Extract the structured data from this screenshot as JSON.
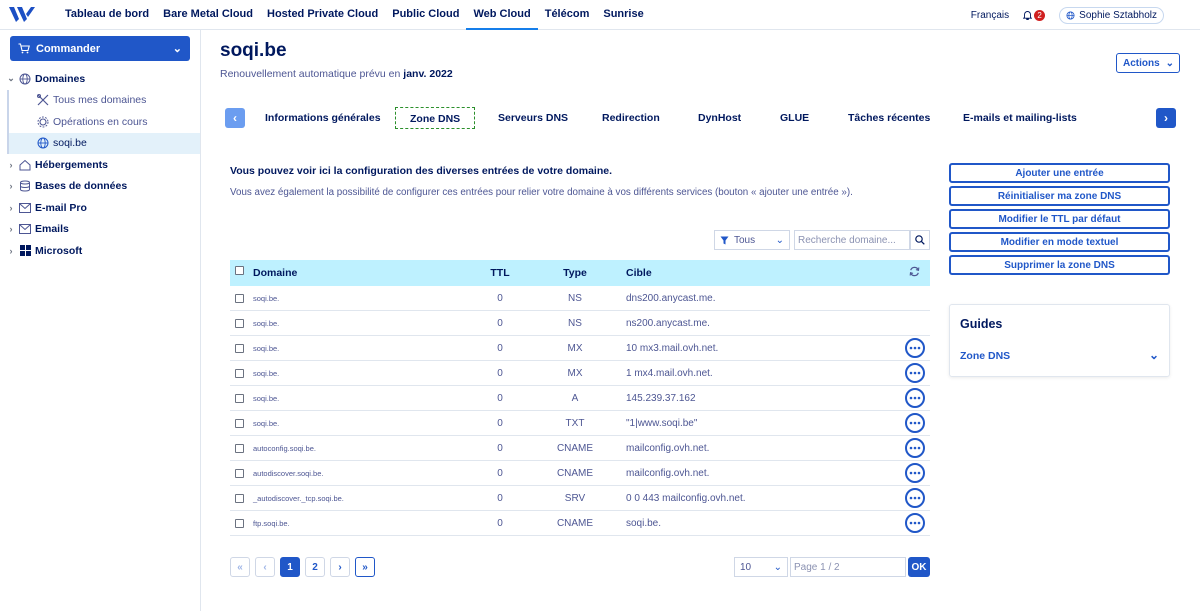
{
  "topnav": {
    "links": [
      "Tableau de bord",
      "Bare Metal Cloud",
      "Hosted Private Cloud",
      "Public Cloud",
      "Web Cloud",
      "Télécom",
      "Sunrise"
    ],
    "active_index": 4,
    "language": "Français",
    "notif_count": "2",
    "user_name": "Sophie Sztabholz"
  },
  "sidebar": {
    "command_label": "Commander",
    "domaines": "Domaines",
    "sub_items": [
      "Tous mes domaines",
      "Opérations en cours",
      "soqi.be"
    ],
    "sections": [
      "Hébergements",
      "Bases de données",
      "E-mail Pro",
      "Emails",
      "Microsoft"
    ]
  },
  "header": {
    "title": "soqi.be",
    "renewal_prefix": "Renouvellement automatique prévu en ",
    "renewal_date": "janv. 2022",
    "actions_label": "Actions"
  },
  "tabs": [
    "Informations générales",
    "Zone DNS",
    "Serveurs DNS",
    "Redirection",
    "DynHost",
    "GLUE",
    "Tâches récentes",
    "E-mails et mailing-lists"
  ],
  "tabs_active_index": 1,
  "intro": {
    "line1": "Vous pouvez voir ici la configuration des diverses entrées de votre domaine.",
    "line2": "Vous avez également la possibilité de configurer ces entrées pour relier votre domaine à vos différents services (bouton « ajouter une entrée »)."
  },
  "filter": {
    "select_value": "Tous",
    "search_placeholder": "Recherche domaine..."
  },
  "table": {
    "headers": {
      "domain": "Domaine",
      "ttl": "TTL",
      "type": "Type",
      "target": "Cible"
    },
    "rows": [
      {
        "domain": "soqi.be.",
        "ttl": "0",
        "type": "NS",
        "target": "dns200.anycast.me.",
        "menu": false
      },
      {
        "domain": "soqi.be.",
        "ttl": "0",
        "type": "NS",
        "target": "ns200.anycast.me.",
        "menu": false
      },
      {
        "domain": "soqi.be.",
        "ttl": "0",
        "type": "MX",
        "target": "10 mx3.mail.ovh.net.",
        "menu": true
      },
      {
        "domain": "soqi.be.",
        "ttl": "0",
        "type": "MX",
        "target": "1 mx4.mail.ovh.net.",
        "menu": true
      },
      {
        "domain": "soqi.be.",
        "ttl": "0",
        "type": "A",
        "target": "145.239.37.162",
        "menu": true
      },
      {
        "domain": "soqi.be.",
        "ttl": "0",
        "type": "TXT",
        "target": "\"1|www.soqi.be\"",
        "menu": true
      },
      {
        "domain": "autoconfig.soqi.be.",
        "ttl": "0",
        "type": "CNAME",
        "target": "mailconfig.ovh.net.",
        "menu": true
      },
      {
        "domain": "autodiscover.soqi.be.",
        "ttl": "0",
        "type": "CNAME",
        "target": "mailconfig.ovh.net.",
        "menu": true
      },
      {
        "domain": "_autodiscover._tcp.soqi.be.",
        "ttl": "0",
        "type": "SRV",
        "target": "0 0 443 mailconfig.ovh.net.",
        "menu": true
      },
      {
        "domain": "ftp.soqi.be.",
        "ttl": "0",
        "type": "CNAME",
        "target": "soqi.be.",
        "menu": true
      }
    ]
  },
  "pagination": {
    "pages": [
      "1",
      "2"
    ],
    "current": "1",
    "page_size": "10",
    "page_placeholder": "Page 1 / 2",
    "ok_label": "OK"
  },
  "side_buttons": [
    "Ajouter une entrée",
    "Réinitialiser ma zone DNS",
    "Modifier le TTL par défaut",
    "Modifier en mode textuel",
    "Supprimer la zone DNS"
  ],
  "guides": {
    "title": "Guides",
    "link": "Zone DNS"
  },
  "colors": {
    "primary": "#2057c8",
    "header_bg": "#bef1ff",
    "text_dark": "#00185e"
  }
}
